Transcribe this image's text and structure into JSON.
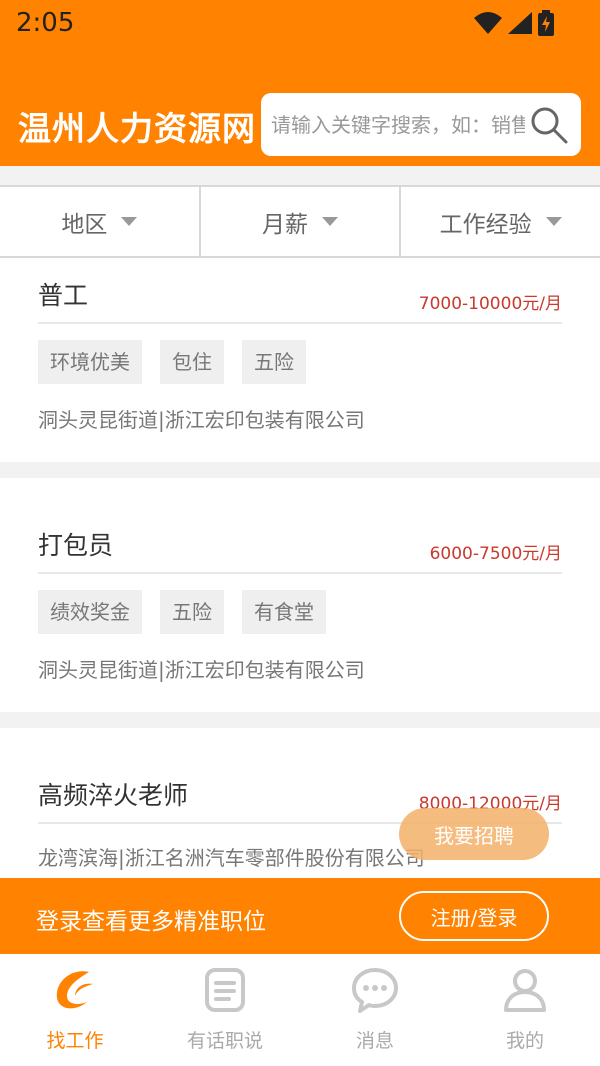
{
  "status": {
    "time": "2:05"
  },
  "header": {
    "title": "温州人力资源网",
    "search_placeholder": "请输入关键字搜索，如：销售"
  },
  "filters": [
    {
      "label": "地区"
    },
    {
      "label": "月薪"
    },
    {
      "label": "工作经验"
    }
  ],
  "jobs": [
    {
      "title": "普工",
      "salary": "7000-10000元/月",
      "tags": [
        "环境优美",
        "包住",
        "五险"
      ],
      "company": "洞头灵昆街道|浙江宏印包装有限公司"
    },
    {
      "title": "打包员",
      "salary": "6000-7500元/月",
      "tags": [
        "绩效奖金",
        "五险",
        "有食堂"
      ],
      "company": "洞头灵昆街道|浙江宏印包装有限公司"
    },
    {
      "title": "高频淬火老师",
      "salary": "8000-12000元/月",
      "tags": [],
      "company": "龙湾滨海|浙江名洲汽车零部件股份有限公司"
    }
  ],
  "fab": {
    "label": "我要招聘"
  },
  "login_banner": {
    "text": "登录查看更多精准职位",
    "button": "注册/登录"
  },
  "nav": [
    {
      "label": "找工作",
      "icon": "job-logo-icon",
      "active": true
    },
    {
      "label": "有话职说",
      "icon": "document-icon",
      "active": false
    },
    {
      "label": "消息",
      "icon": "chat-bubble-icon",
      "active": false
    },
    {
      "label": "我的",
      "icon": "person-icon",
      "active": false
    }
  ],
  "colors": {
    "brand": "#ff8200",
    "salary": "#c9392c"
  }
}
